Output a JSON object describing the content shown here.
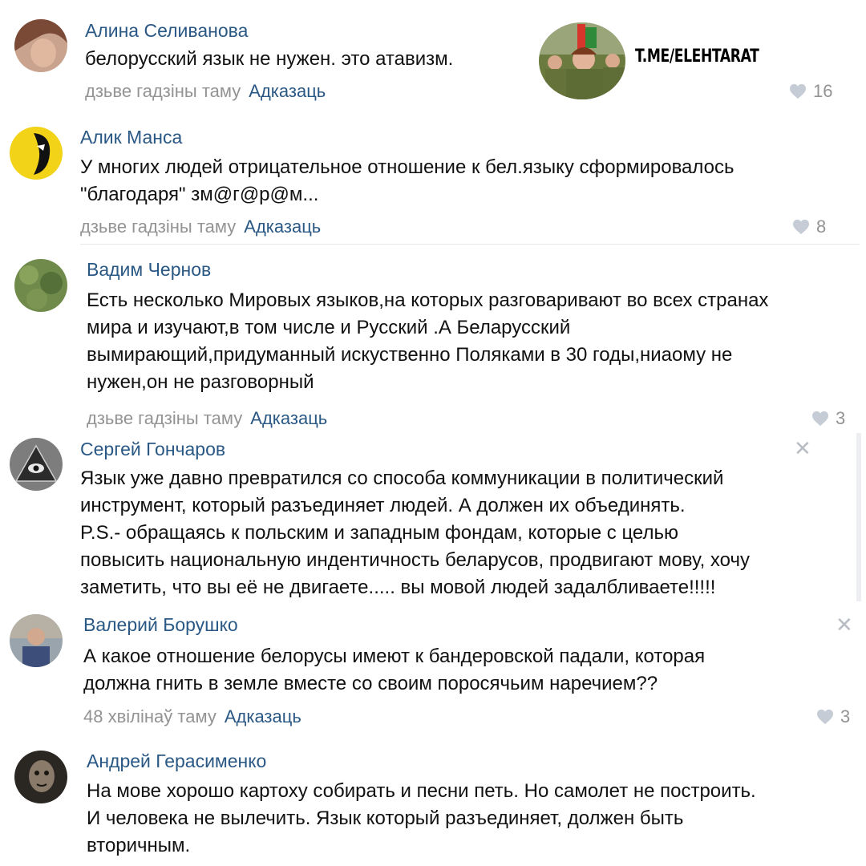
{
  "watermark": {
    "text": "T.ME/ELEHTARAT"
  },
  "icons": {
    "like": "heart-icon",
    "delete": "close-icon"
  },
  "colors": {
    "name": "#2a5885",
    "meta": "#939393",
    "text": "#111111"
  },
  "comments": [
    {
      "author": "Алина Селиванова",
      "text": "белорусский язык не нужен. это атавизм.",
      "time": "дзьве гадзіны таму",
      "reply": "Адказаць",
      "likes": "16"
    },
    {
      "author": "Алик Манса",
      "text": "У многих людей отрицательное отношение к бел.языку сформировалось\n\"благодаря\" зм@г@р@м...",
      "time": "дзьве гадзіны таму",
      "reply": "Адказаць",
      "likes": "8"
    },
    {
      "author": "Вадим Чернов",
      "text": "Есть несколько Мировых языков,на которых разговаривают во всех странах\nмира и изучают,в том числе и Русский .А Беларусский\nвымирающий,придуманный искуственно Поляками в 30 годы,ниаому не\nнужен,он не разговорный",
      "time": "дзьве гадзіны таму",
      "reply": "Адказаць",
      "likes": "3"
    },
    {
      "author": "Сергей Гончаров",
      "text": "Язык уже давно превратился со способа коммуникации в политический\nинструмент, который разъединяет людей. А должен их объединять.\nP.S.- обращаясь к польским и западным фондам, которые с целью\nповысить национальную индентичность беларусов, продвигают мову, хочу\nзаметить, что вы её не двигаете..... вы мовой людей задалбливаете!!!!!"
    },
    {
      "author": "Валерий Борушко",
      "text": "А какое отношение белорусы имеют к бандеровской падали, которая\nдолжна гнить в земле вместе со своим поросячьим наречием??",
      "time": "48 хвілінаў таму",
      "reply": "Адказаць",
      "likes": "3"
    },
    {
      "author": "Андрей Герасименко",
      "text": "На мове хорошо картоху собирать и песни петь. Но самолет не построить.\nИ человека не вылечить. Язык который разъединяет, должен быть\nвторичным."
    }
  ]
}
